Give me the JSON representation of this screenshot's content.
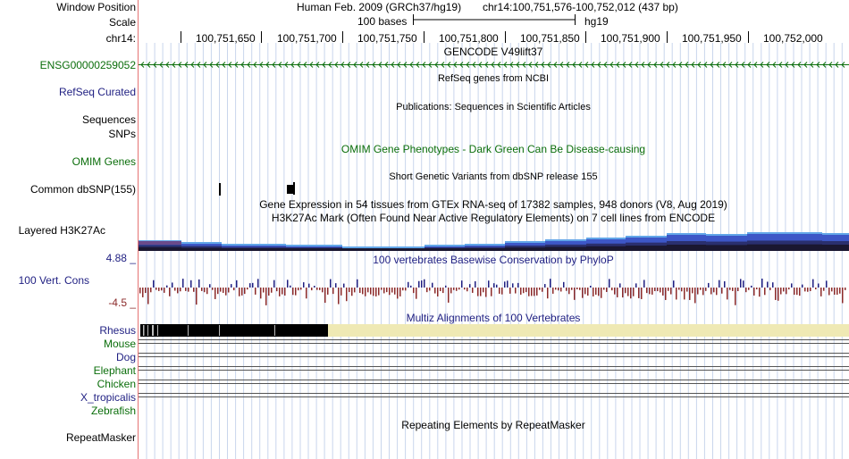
{
  "header": {
    "window_position_label": "Window Position",
    "assembly": "Human Feb. 2009 (GRCh37/hg19)",
    "position": "chr14:100,751,576-100,752,012 (437 bp)",
    "scale_label": "Scale",
    "scale_text": "100 bases",
    "db": "hg19",
    "chrom_label": "chr14:",
    "ticks": [
      "100,751,650",
      "100,751,700",
      "100,751,750",
      "100,751,800",
      "100,751,850",
      "100,751,900",
      "100,751,950",
      "100,752,000"
    ]
  },
  "tracks": {
    "gencode": {
      "title": "GENCODE V49lift37",
      "gene": "ENSG00000259052"
    },
    "refseq": {
      "title": "RefSeq genes from NCBI",
      "label": "RefSeq Curated"
    },
    "publications": {
      "title": "Publications: Sequences in Scientific Articles",
      "label1": "Sequences",
      "label2": "SNPs"
    },
    "omim": {
      "title": "OMIM Gene Phenotypes - Dark Green Can Be Disease-causing",
      "label": "OMIM Genes"
    },
    "dbsnp": {
      "title": "Short Genetic Variants from dbSNP release 155",
      "label": "Common dbSNP(155)"
    },
    "gtex": {
      "title": "Gene Expression in 54 tissues from GTEx RNA-seq of 17382 samples, 948 donors (V8, Aug 2019)"
    },
    "h3k27ac": {
      "title": "H3K27Ac Mark (Often Found Near Active Regulatory Elements) on 7 cell lines from ENCODE",
      "label": "Layered H3K27Ac"
    },
    "conservation": {
      "title": "100 vertebrates Basewise Conservation by PhyloP",
      "label": "100 Vert. Cons",
      "ymax": "4.88 _",
      "ymin": "-4.5 _"
    },
    "multiz": {
      "title": "Multiz Alignments of 100 Vertebrates",
      "species": [
        {
          "name": "Rhesus",
          "color": "#1f1f82"
        },
        {
          "name": "Mouse",
          "color": "#0b6e0b"
        },
        {
          "name": "Dog",
          "color": "#1f1f82"
        },
        {
          "name": "Elephant",
          "color": "#0b6e0b"
        },
        {
          "name": "Chicken",
          "color": "#0b6e0b"
        },
        {
          "name": "X_tropicalis",
          "color": "#1f1f82"
        },
        {
          "name": "Zebrafish",
          "color": "#0b6e0b"
        }
      ]
    },
    "repeatmasker": {
      "title": "Repeating Elements by RepeatMasker",
      "label": "RepeatMasker"
    }
  },
  "colors": {
    "grid": "#c9d6ec",
    "gene": "#0b6e0b",
    "cons_pos": "#1f1f82",
    "cons_neg": "#8b2a2a",
    "align_block": "#000000",
    "align_gap": "#efe9b4",
    "left_divider": "#e57373"
  }
}
